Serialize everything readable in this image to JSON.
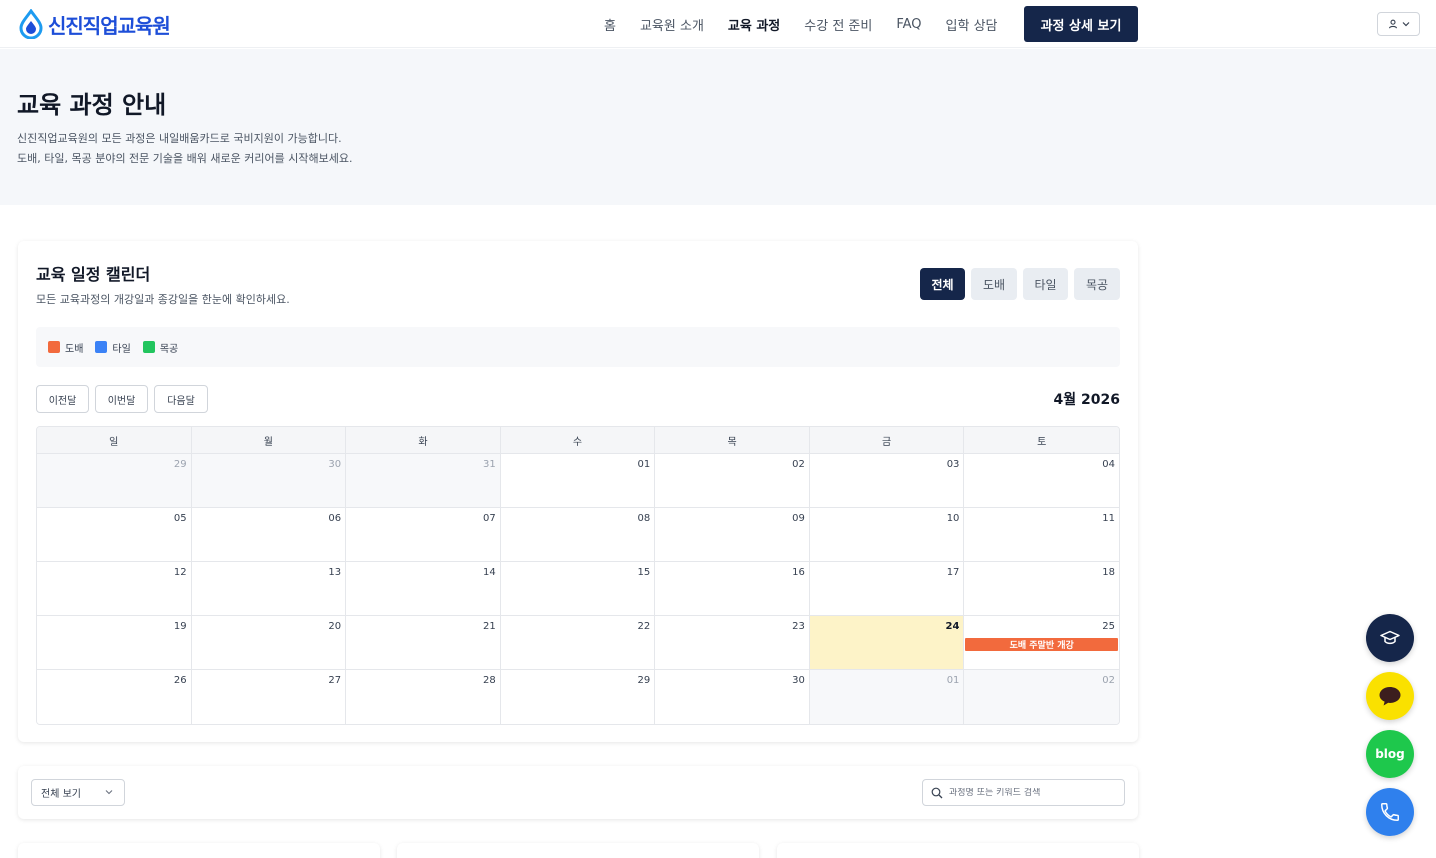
{
  "brand": {
    "logo_text": "신진직업교육원"
  },
  "nav": {
    "items": [
      {
        "label": "홈",
        "active": false
      },
      {
        "label": "교육원 소개",
        "active": false
      },
      {
        "label": "교육 과정",
        "active": true
      },
      {
        "label": "수강 전 준비",
        "active": false
      },
      {
        "label": "FAQ",
        "active": false
      },
      {
        "label": "입학 상담",
        "active": false
      }
    ],
    "cta_label": "과정 상세 보기"
  },
  "hero": {
    "title": "교육 과정 안내",
    "desc_line1": "신진직업교육원의 모든 과정은 내일배움카드로 국비지원이 가능합니다.",
    "desc_line2": "도배, 타일, 목공 분야의 전문 기술을 배워 새로운 커리어를 시작해보세요."
  },
  "calendar": {
    "title": "교육 일정 캘린더",
    "subtitle": "모든 교육과정의 개강일과 종강일을 한눈에 확인하세요.",
    "filters": [
      "전체",
      "도배",
      "타일",
      "목공"
    ],
    "active_filter": "전체",
    "legend": [
      {
        "label": "도배",
        "color": "#f26a3d"
      },
      {
        "label": "타일",
        "color": "#3b82f6"
      },
      {
        "label": "목공",
        "color": "#22c55e"
      }
    ],
    "nav_buttons": {
      "prev": "이전달",
      "current": "이번달",
      "next": "다음달"
    },
    "month_label": "4월 2026",
    "weekdays": [
      "일",
      "월",
      "화",
      "수",
      "목",
      "금",
      "토"
    ],
    "weeks": [
      [
        {
          "day": "29",
          "other": true
        },
        {
          "day": "30",
          "other": true
        },
        {
          "day": "31",
          "other": true
        },
        {
          "day": "01"
        },
        {
          "day": "02"
        },
        {
          "day": "03"
        },
        {
          "day": "04"
        }
      ],
      [
        {
          "day": "05"
        },
        {
          "day": "06"
        },
        {
          "day": "07"
        },
        {
          "day": "08"
        },
        {
          "day": "09"
        },
        {
          "day": "10"
        },
        {
          "day": "11"
        }
      ],
      [
        {
          "day": "12"
        },
        {
          "day": "13"
        },
        {
          "day": "14"
        },
        {
          "day": "15"
        },
        {
          "day": "16"
        },
        {
          "day": "17"
        },
        {
          "day": "18"
        }
      ],
      [
        {
          "day": "19"
        },
        {
          "day": "20"
        },
        {
          "day": "21"
        },
        {
          "day": "22"
        },
        {
          "day": "23"
        },
        {
          "day": "24",
          "today": true
        },
        {
          "day": "25",
          "event": "도배 주말반 개강",
          "event_color": "#f26a3d"
        }
      ],
      [
        {
          "day": "26"
        },
        {
          "day": "27"
        },
        {
          "day": "28"
        },
        {
          "day": "29"
        },
        {
          "day": "30"
        },
        {
          "day": "01",
          "other": true
        },
        {
          "day": "02",
          "other": true
        }
      ]
    ]
  },
  "search": {
    "select_value": "전체 보기",
    "placeholder": "과정명 또는 키워드 검색"
  },
  "floating": {
    "blog_label": "blog",
    "colors": {
      "edu": "#15264a",
      "kakao": "#fae100",
      "blog": "#1ec84c",
      "phone": "#2f80ed"
    }
  }
}
